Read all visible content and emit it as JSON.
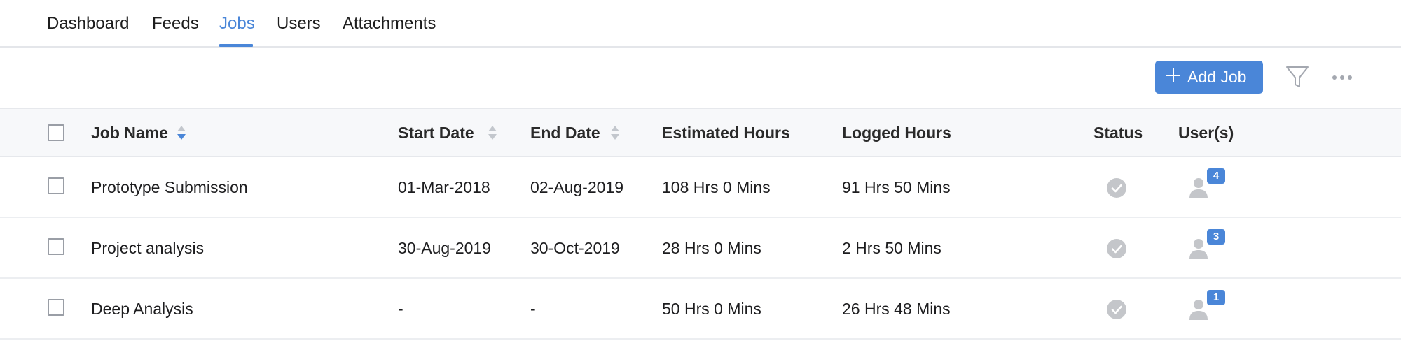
{
  "tabs": [
    {
      "label": "Dashboard",
      "active": false
    },
    {
      "label": "Feeds",
      "active": false
    },
    {
      "label": "Jobs",
      "active": true
    },
    {
      "label": "Users",
      "active": false
    },
    {
      "label": "Attachments",
      "active": false
    }
  ],
  "toolbar": {
    "add_label": "Add Job",
    "filter_icon": "filter-icon",
    "more_icon": "more-icon"
  },
  "table": {
    "columns": [
      "Job Name",
      "Start Date",
      "End Date",
      "Estimated Hours",
      "Logged Hours",
      "Status",
      "User(s)"
    ],
    "rows": [
      {
        "job_name": "Prototype Submission",
        "start_date": "01-Mar-2018",
        "end_date": "02-Aug-2019",
        "estimated": "108 Hrs 0 Mins",
        "logged": "91 Hrs 50 Mins",
        "status_icon": "check-circle-icon",
        "users_count": "4"
      },
      {
        "job_name": "Project analysis",
        "start_date": "30-Aug-2019",
        "end_date": "30-Oct-2019",
        "estimated": "28 Hrs 0 Mins",
        "logged": "2 Hrs 50 Mins",
        "status_icon": "check-circle-icon",
        "users_count": "3"
      },
      {
        "job_name": "Deep Analysis",
        "start_date": "-",
        "end_date": "-",
        "estimated": "50 Hrs 0 Mins",
        "logged": "26 Hrs 48 Mins",
        "status_icon": "check-circle-icon",
        "users_count": "1"
      }
    ]
  },
  "colors": {
    "accent": "#4a86d8",
    "status_done": "#c4c6ca",
    "header_bg": "#f7f8fa"
  }
}
